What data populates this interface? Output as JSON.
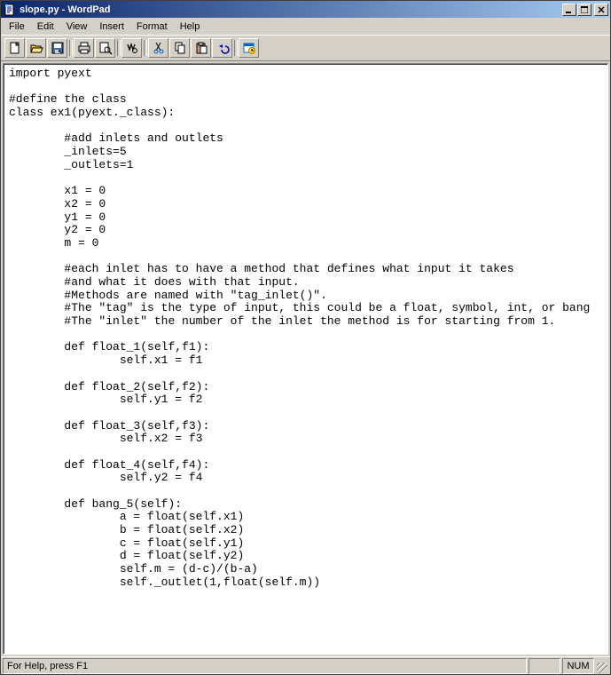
{
  "titlebar": {
    "title": "slope.py - WordPad"
  },
  "menu": {
    "file": "File",
    "edit": "Edit",
    "view": "View",
    "insert": "Insert",
    "format": "Format",
    "help": "Help"
  },
  "status": {
    "help": "For Help, press F1",
    "num": "NUM"
  },
  "content": "import pyext\n\n#define the class\nclass ex1(pyext._class):\n\n\t#add inlets and outlets\n\t_inlets=5\n\t_outlets=1\n\n\tx1 = 0\n\tx2 = 0\n\ty1 = 0\n\ty2 = 0\n\tm = 0\n\n\t#each inlet has to have a method that defines what input it takes\n\t#and what it does with that input.\n\t#Methods are named with \"tag_inlet()\".\n\t#The \"tag\" is the type of input, this could be a float, symbol, int, or bang\n\t#The \"inlet\" the number of the inlet the method is for starting from 1.\n\n\tdef float_1(self,f1):\n\t\tself.x1 = f1\n\n\tdef float_2(self,f2):\n\t\tself.y1 = f2\n\n\tdef float_3(self,f3):\n\t\tself.x2 = f3\n\n\tdef float_4(self,f4):\n\t\tself.y2 = f4\n\n\tdef bang_5(self):\n\t\ta = float(self.x1)\n\t\tb = float(self.x2)\n\t\tc = float(self.y1)\n\t\td = float(self.y2)\n\t\tself.m = (d-c)/(b-a)\n\t\tself._outlet(1,float(self.m))"
}
